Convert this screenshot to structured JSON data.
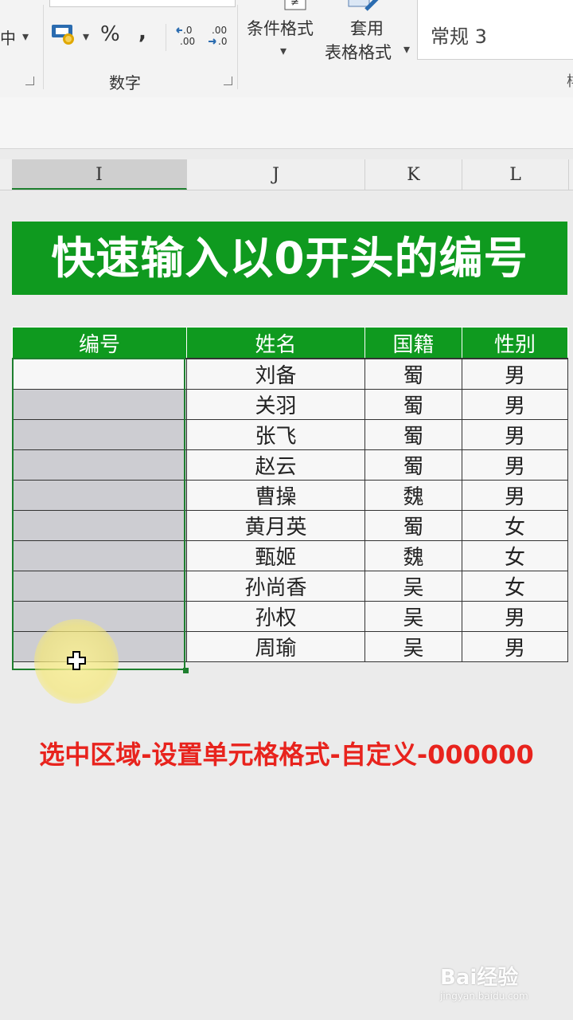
{
  "ribbon": {
    "align_partial": "中",
    "percent_symbol": "%",
    "comma_symbol": ",",
    "inc_decimal": "←0\n.00",
    "dec_decimal": ".00\n→.0",
    "number_group_label": "数字",
    "conditional_format_label": "条件格式",
    "table_format_line1": "套用",
    "table_format_line2": "表格格式",
    "style_box_text": "常规 3"
  },
  "columns": [
    "I",
    "J",
    "K",
    "L"
  ],
  "banner_title": "快速输入以0开头的编号",
  "table": {
    "headers": [
      "编号",
      "姓名",
      "国籍",
      "性别"
    ],
    "rows": [
      [
        "",
        "刘备",
        "蜀",
        "男"
      ],
      [
        "",
        "关羽",
        "蜀",
        "男"
      ],
      [
        "",
        "张飞",
        "蜀",
        "男"
      ],
      [
        "",
        "赵云",
        "蜀",
        "男"
      ],
      [
        "",
        "曹操",
        "魏",
        "男"
      ],
      [
        "",
        "黄月英",
        "蜀",
        "女"
      ],
      [
        "",
        "甄姬",
        "魏",
        "女"
      ],
      [
        "",
        "孙尚香",
        "吴",
        "女"
      ],
      [
        "",
        "孙权",
        "吴",
        "男"
      ],
      [
        "",
        "周瑜",
        "吴",
        "男"
      ]
    ]
  },
  "instruction": "选中区域-设置单元格格式-自定义-000000",
  "watermark": {
    "brand": "Bai经验",
    "url": "jingyan.baidu.com"
  },
  "colors": {
    "header_green": "#0f9a1f",
    "instruction_red": "#e8231d",
    "selection_border": "#1e7f2f"
  }
}
